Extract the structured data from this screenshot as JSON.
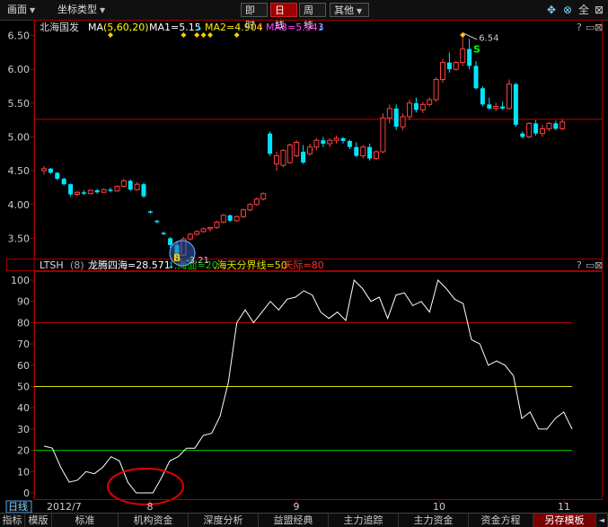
{
  "toolbar": {
    "menu_label": "画面",
    "coord_label": "坐标类型",
    "btn_intraday": "即时",
    "btn_daily": "日线",
    "btn_weekly": "周线",
    "btn_other": "其他",
    "icons": [
      "move-icon",
      "lock-icon",
      "full-label",
      "close-icon"
    ],
    "full_label": "全"
  },
  "price_panel": {
    "stock_name": "北海国发",
    "ma_label": "MA",
    "ma_params": "(5,60,20)",
    "ma1": "MA1=5.15",
    "ma1_arrow": "↓",
    "ma2": "MA2=4.904",
    "ma2_arrow": "↑",
    "ma3": "MA3=5.543",
    "ma3_arrow": "↓",
    "high_label": "6.54",
    "low_label": "3.21",
    "s_marker": "S",
    "b_marker": "B",
    "y_ticks": [
      "6.50",
      "6.00",
      "5.50",
      "5.00",
      "4.50",
      "4.00",
      "3.50"
    ],
    "colors": {
      "up": "#ff4040",
      "down": "#00e5ff",
      "ma1": "#ffffff",
      "ma2": "#ffee00",
      "ma3": "#ff44ff",
      "hline": "#c00000"
    }
  },
  "ind_panel": {
    "name": "LTSH",
    "param": "(8)",
    "line_label": "龙腾四海=28.571",
    "arrow": "↓",
    "sea_label": ",海面=20",
    "sky_label": ",海天分界线=50",
    "sky_top": ",天际=80",
    "y_ticks": [
      "100",
      "90",
      "80",
      "70",
      "60",
      "50",
      "40",
      "30",
      "20",
      "10",
      "0"
    ],
    "colors": {
      "line": "#ffffff",
      "sea": "#00cc00",
      "mid": "#e0e000",
      "top": "#cc0000"
    }
  },
  "x_axis": {
    "period_label": "日线",
    "start_label": "2012/7",
    "months": [
      "8",
      "9",
      "10",
      "11"
    ]
  },
  "bottom_tabs": {
    "items": [
      "指标",
      "模版",
      "标准",
      "机构资金",
      "深度分析",
      "益盟经典",
      "主力追踪",
      "主力资金",
      "资金方程",
      "另存模板"
    ],
    "arrow_left": "◄",
    "arrow_right": "►"
  },
  "chart_data": {
    "type": "line",
    "ohlc_type": "candlestick",
    "price_range": [
      3.2,
      6.6
    ],
    "indicator_range": [
      0,
      100
    ],
    "candles": [
      [
        4.5,
        4.57,
        4.44,
        4.53
      ],
      [
        4.53,
        4.54,
        4.45,
        4.47
      ],
      [
        4.47,
        4.48,
        4.36,
        4.38
      ],
      [
        4.38,
        4.4,
        4.28,
        4.3
      ],
      [
        4.3,
        4.31,
        4.12,
        4.15
      ],
      [
        4.15,
        4.2,
        4.13,
        4.18
      ],
      [
        4.18,
        4.21,
        4.14,
        4.16
      ],
      [
        4.16,
        4.22,
        4.15,
        4.21
      ],
      [
        4.21,
        4.23,
        4.16,
        4.18
      ],
      [
        4.18,
        4.24,
        4.17,
        4.22
      ],
      [
        4.22,
        4.25,
        4.18,
        4.2
      ],
      [
        4.2,
        4.28,
        4.19,
        4.27
      ],
      [
        4.27,
        4.38,
        4.25,
        4.35
      ],
      [
        4.35,
        4.37,
        4.2,
        4.22
      ],
      [
        4.22,
        4.33,
        4.2,
        4.3
      ],
      [
        4.3,
        4.32,
        4.1,
        4.12
      ],
      [
        3.9,
        3.91,
        3.86,
        3.88
      ],
      [
        3.76,
        3.77,
        3.72,
        3.74
      ],
      [
        3.58,
        3.6,
        3.55,
        3.56
      ],
      [
        3.5,
        3.52,
        3.36,
        3.4
      ],
      [
        3.4,
        3.45,
        3.21,
        3.25
      ],
      [
        3.25,
        3.52,
        3.24,
        3.49
      ],
      [
        3.49,
        3.58,
        3.47,
        3.56
      ],
      [
        3.56,
        3.62,
        3.54,
        3.6
      ],
      [
        3.6,
        3.66,
        3.58,
        3.64
      ],
      [
        3.64,
        3.67,
        3.6,
        3.66
      ],
      [
        3.66,
        3.76,
        3.64,
        3.74
      ],
      [
        3.74,
        3.86,
        3.72,
        3.84
      ],
      [
        3.84,
        3.85,
        3.74,
        3.76
      ],
      [
        3.76,
        3.84,
        3.74,
        3.82
      ],
      [
        3.82,
        3.94,
        3.8,
        3.92
      ],
      [
        3.92,
        4.02,
        3.9,
        4.0
      ],
      [
        4.0,
        4.1,
        3.98,
        4.08
      ],
      [
        4.08,
        4.18,
        4.06,
        4.16
      ],
      [
        5.05,
        5.08,
        4.72,
        4.75
      ],
      [
        4.6,
        4.78,
        4.5,
        4.72
      ],
      [
        4.58,
        4.82,
        4.55,
        4.8
      ],
      [
        4.62,
        4.9,
        4.6,
        4.88
      ],
      [
        4.72,
        4.95,
        4.7,
        4.92
      ],
      [
        4.78,
        4.88,
        4.6,
        4.62
      ],
      [
        4.75,
        4.9,
        4.72,
        4.85
      ],
      [
        4.85,
        4.98,
        4.8,
        4.95
      ],
      [
        4.95,
        5.0,
        4.85,
        4.9
      ],
      [
        4.9,
        4.98,
        4.85,
        4.95
      ],
      [
        4.95,
        5.02,
        4.9,
        4.98
      ],
      [
        4.98,
        5.0,
        4.9,
        4.94
      ],
      [
        4.94,
        4.96,
        4.82,
        4.85
      ],
      [
        4.85,
        4.92,
        4.7,
        4.72
      ],
      [
        4.72,
        4.88,
        4.68,
        4.85
      ],
      [
        4.85,
        4.9,
        4.65,
        4.68
      ],
      [
        4.68,
        4.8,
        4.66,
        4.78
      ],
      [
        4.78,
        5.35,
        4.76,
        5.28
      ],
      [
        5.28,
        5.48,
        5.2,
        5.42
      ],
      [
        5.42,
        5.48,
        5.1,
        5.15
      ],
      [
        5.15,
        5.35,
        5.1,
        5.3
      ],
      [
        5.3,
        5.55,
        5.25,
        5.5
      ],
      [
        5.5,
        5.58,
        5.36,
        5.4
      ],
      [
        5.4,
        5.52,
        5.35,
        5.48
      ],
      [
        5.48,
        5.58,
        5.45,
        5.55
      ],
      [
        5.55,
        5.88,
        5.52,
        5.85
      ],
      [
        5.85,
        6.15,
        5.8,
        6.1
      ],
      [
        6.1,
        6.25,
        5.95,
        6.0
      ],
      [
        6.0,
        6.12,
        5.98,
        6.1
      ],
      [
        6.1,
        6.54,
        6.05,
        6.3
      ],
      [
        6.3,
        6.45,
        6.0,
        6.05
      ],
      [
        6.05,
        6.12,
        5.7,
        5.72
      ],
      [
        5.72,
        5.75,
        5.45,
        5.48
      ],
      [
        5.48,
        5.58,
        5.4,
        5.42
      ],
      [
        5.42,
        5.5,
        5.38,
        5.45
      ],
      [
        5.45,
        5.52,
        5.4,
        5.42
      ],
      [
        5.42,
        5.85,
        5.4,
        5.78
      ],
      [
        5.78,
        5.8,
        5.15,
        5.18
      ],
      [
        5.05,
        5.08,
        4.98,
        5.0
      ],
      [
        5.0,
        5.22,
        4.98,
        5.2
      ],
      [
        5.2,
        5.25,
        5.02,
        5.05
      ],
      [
        5.05,
        5.18,
        5.0,
        5.12
      ],
      [
        5.12,
        5.22,
        5.08,
        5.2
      ],
      [
        5.2,
        5.24,
        5.1,
        5.12
      ],
      [
        5.12,
        5.26,
        5.1,
        5.22
      ]
    ],
    "indicator": [
      22,
      21,
      12,
      5,
      6,
      10,
      9,
      12,
      17,
      15,
      5,
      0,
      0,
      0,
      7,
      15,
      17,
      21,
      21,
      27,
      28,
      36,
      52,
      80,
      86,
      80,
      85,
      90,
      86,
      91,
      92,
      95,
      93,
      85,
      82,
      85,
      81,
      100,
      96,
      90,
      92,
      82,
      93,
      94,
      88,
      90,
      85,
      100,
      96,
      91,
      89,
      72,
      70,
      60,
      62,
      60,
      55,
      35,
      38,
      30,
      30,
      35,
      38,
      30
    ]
  }
}
